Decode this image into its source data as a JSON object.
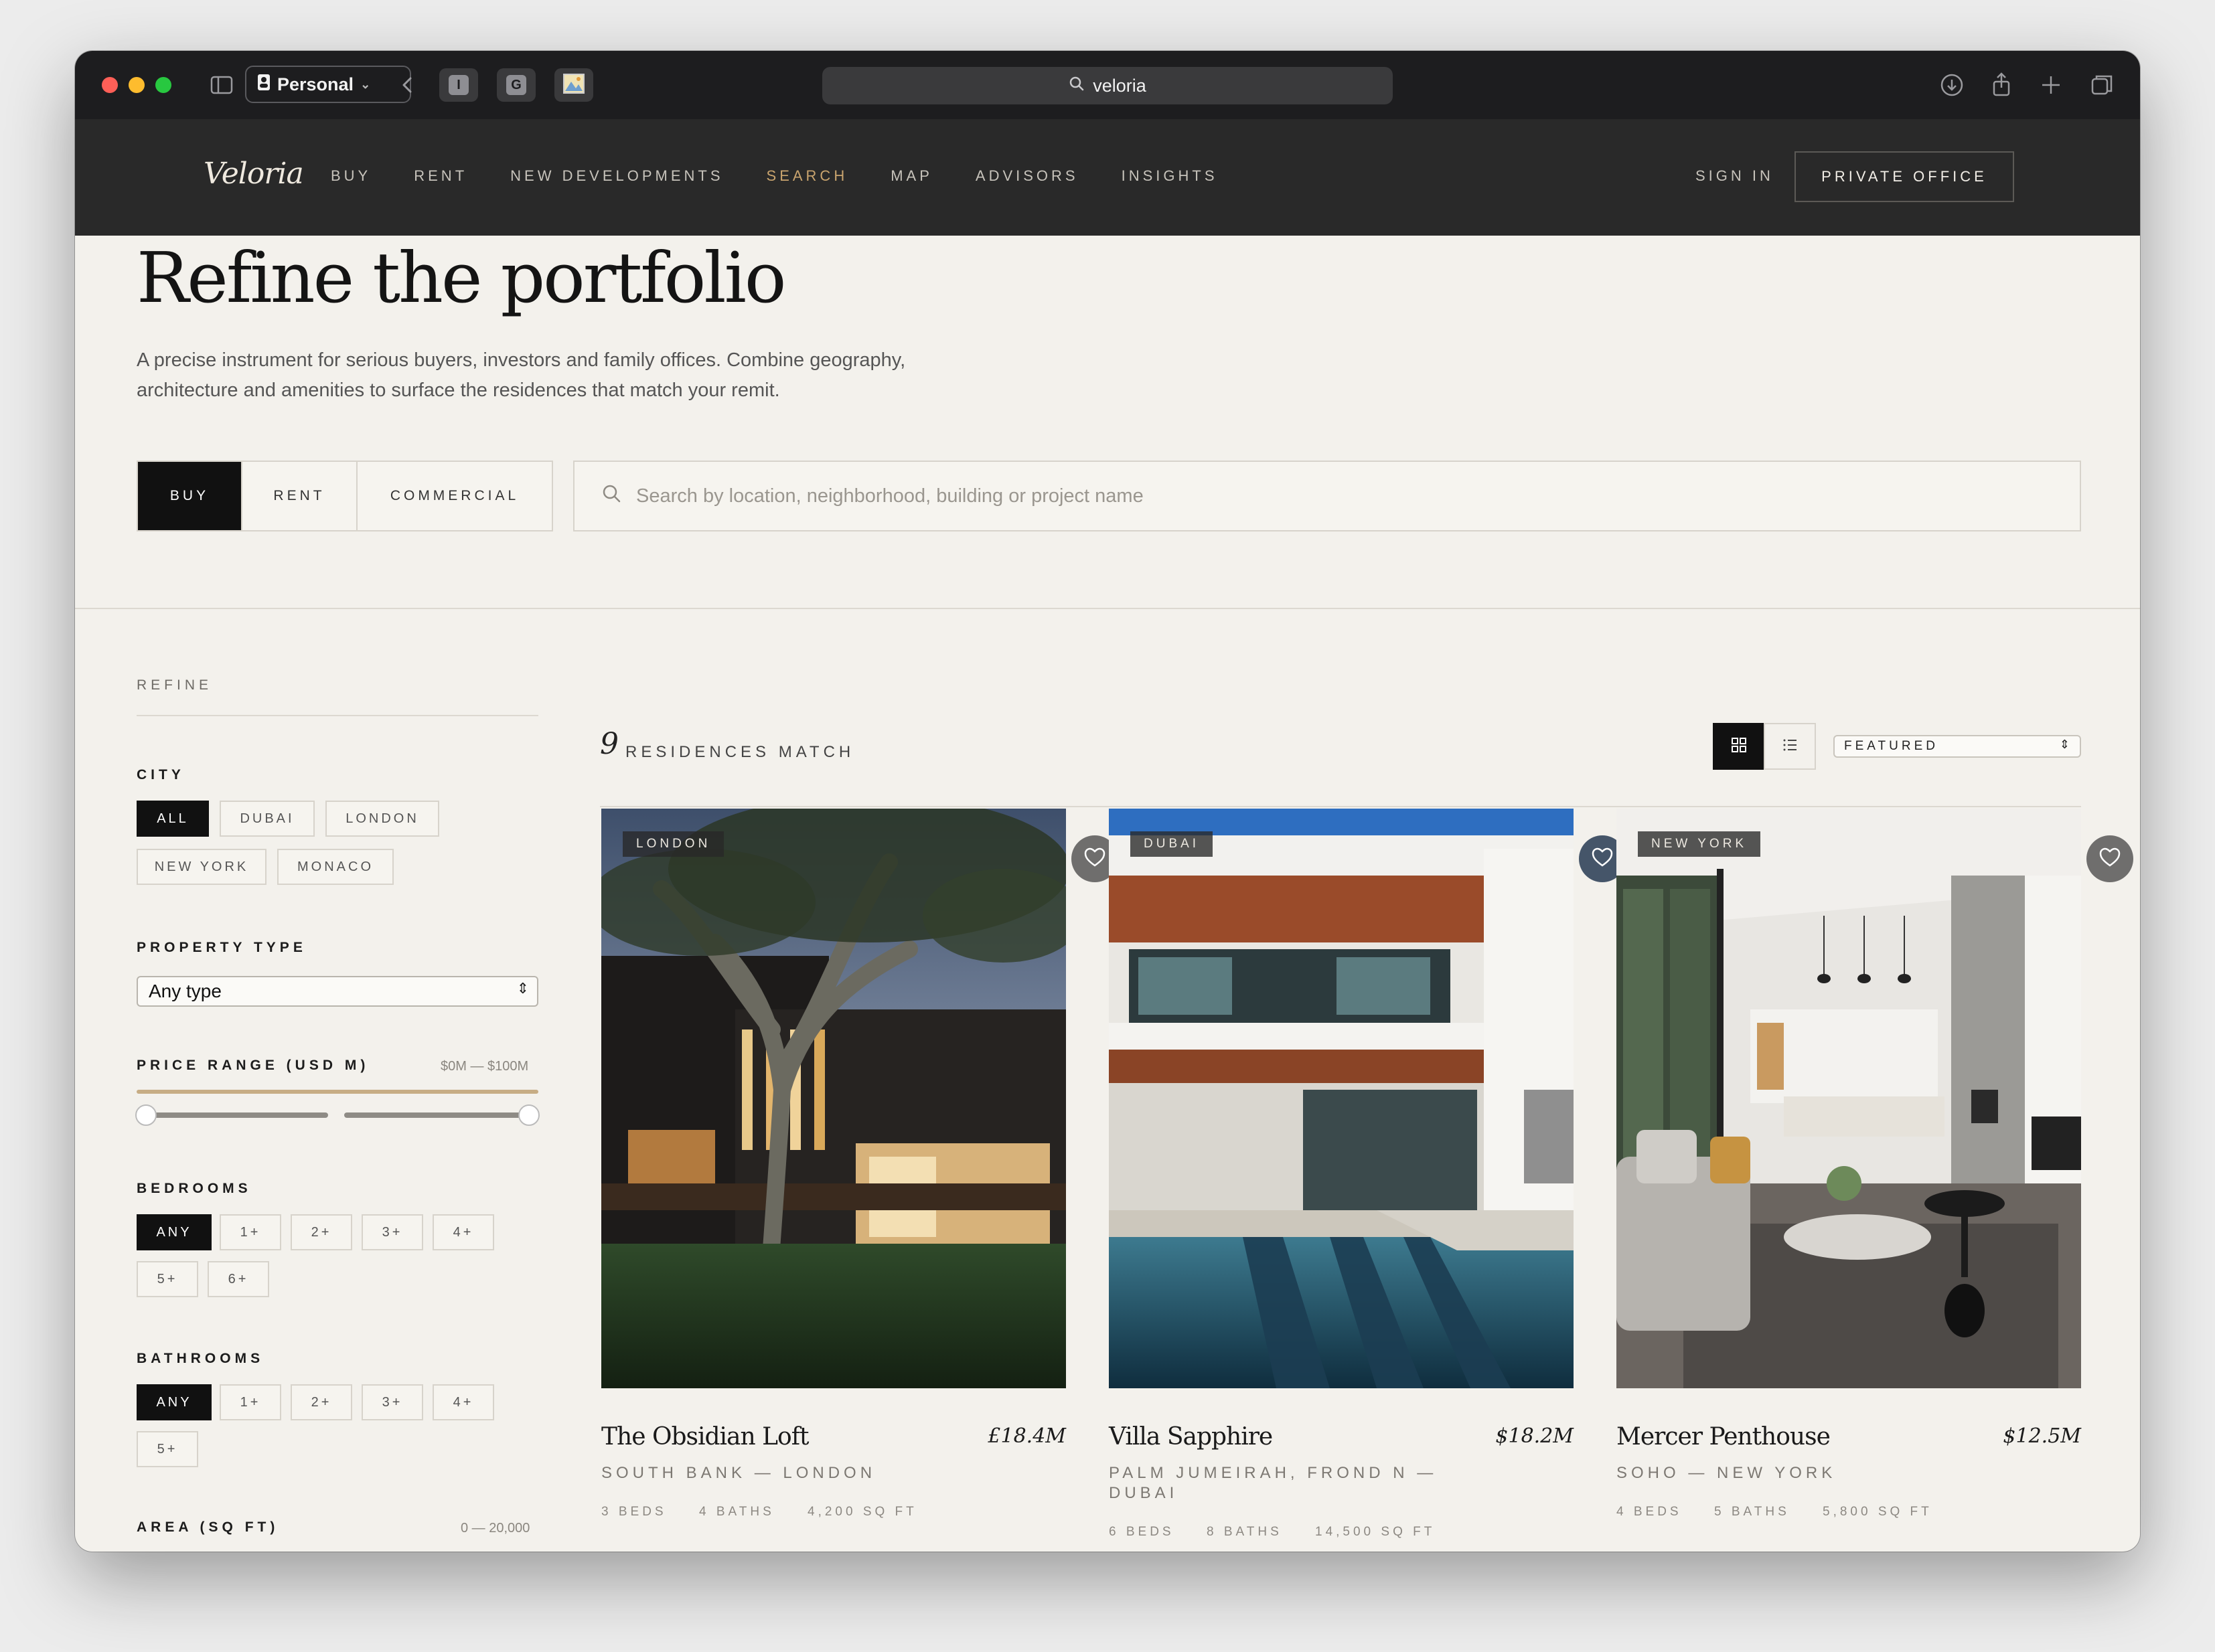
{
  "browser": {
    "profile": "Personal",
    "address": "veloria",
    "tab_icons": [
      "I",
      "G",
      "image-icon"
    ]
  },
  "site": {
    "logo": "Veloria",
    "nav": [
      "BUY",
      "RENT",
      "NEW DEVELOPMENTS",
      "SEARCH",
      "MAP",
      "ADVISORS",
      "INSIGHTS"
    ],
    "active_nav": "SEARCH",
    "sign_in": "SIGN IN",
    "private_office": "PRIVATE OFFICE",
    "accent_color": "#c9a46e"
  },
  "hero": {
    "title": "Refine the portfolio",
    "subtitle": "A precise instrument for serious buyers, investors and family offices. Combine geography, architecture and amenities to surface the residences that match your remit."
  },
  "mode_tabs": [
    "BUY",
    "RENT",
    "COMMERCIAL"
  ],
  "active_mode": "BUY",
  "search": {
    "placeholder": "Search by location, neighborhood, building or project name"
  },
  "filters": {
    "heading": "REFINE",
    "city": {
      "label": "CITY",
      "options": [
        "ALL",
        "DUBAI",
        "LONDON",
        "NEW YORK",
        "MONACO"
      ],
      "selected": "ALL"
    },
    "property_type": {
      "label": "PROPERTY TYPE",
      "value": "Any type"
    },
    "price": {
      "label": "PRICE RANGE (USD M)",
      "range_text": "$0M — $100M",
      "min": 0,
      "max": 100
    },
    "bedrooms": {
      "label": "BEDROOMS",
      "options": [
        "ANY",
        "1+",
        "2+",
        "3+",
        "4+",
        "5+",
        "6+"
      ],
      "selected": "ANY"
    },
    "bathrooms": {
      "label": "BATHROOMS",
      "options": [
        "ANY",
        "1+",
        "2+",
        "3+",
        "4+",
        "5+"
      ],
      "selected": "ANY"
    },
    "area": {
      "label": "AREA (SQ FT)",
      "range_text": "0 — 20,000"
    }
  },
  "results": {
    "count": "9",
    "count_label": "RESIDENCES MATCH",
    "view": "grid",
    "sort": "FEATURED",
    "cards": [
      {
        "tag": "LONDON",
        "title": "The Obsidian Loft",
        "price": "£18.4M",
        "location": "SOUTH BANK — LONDON",
        "beds": "3 BEDS",
        "baths": "4 BATHS",
        "area": "4,200 SQ FT"
      },
      {
        "tag": "DUBAI",
        "title": "Villa Sapphire",
        "price": "$18.2M",
        "location": "PALM JUMEIRAH, FROND N — DUBAI",
        "beds": "6 BEDS",
        "baths": "8 BATHS",
        "area": "14,500 SQ FT"
      },
      {
        "tag": "NEW YORK",
        "title": "Mercer Penthouse",
        "price": "$12.5M",
        "location": "SOHO — NEW YORK",
        "beds": "4 BEDS",
        "baths": "5 BATHS",
        "area": "5,800 SQ FT"
      }
    ]
  }
}
